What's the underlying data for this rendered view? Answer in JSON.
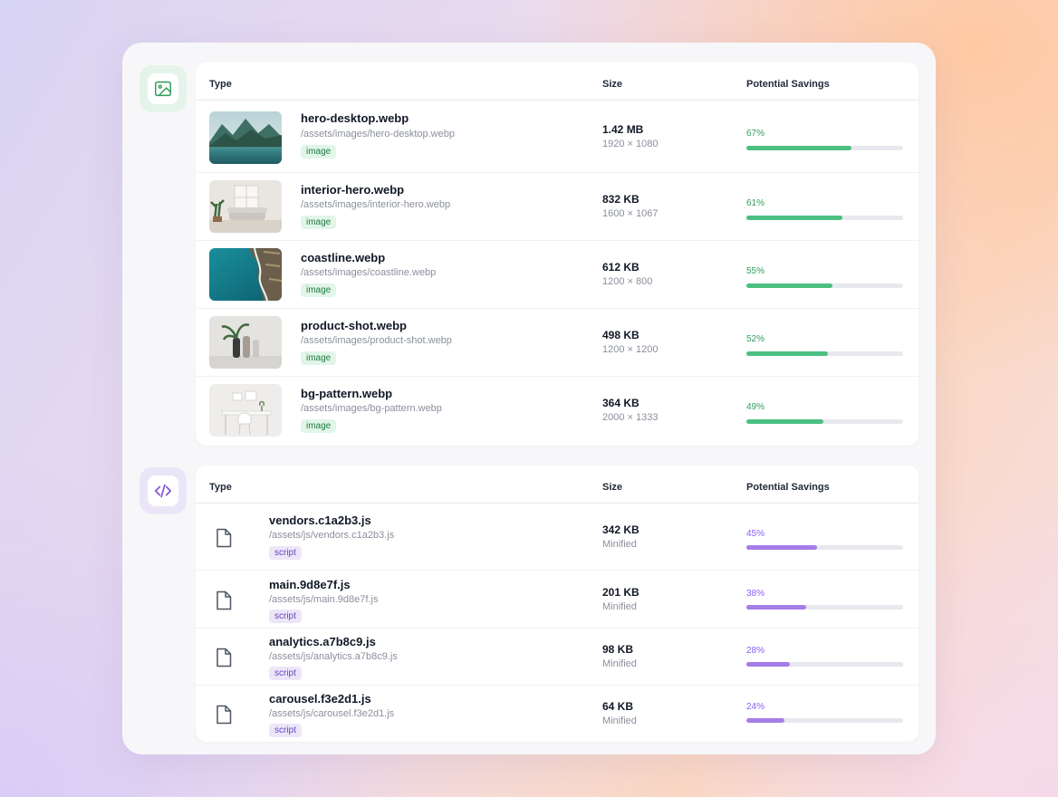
{
  "colors": {
    "image_accent": "#4cc083",
    "script_accent": "#a57de8",
    "track": "#e8e9ee"
  },
  "images_section": {
    "icon": "image-icon",
    "headers": {
      "type": "Type",
      "size": "Size",
      "savings": "Potential Savings"
    },
    "rows": [
      {
        "name": "hero-desktop.webp",
        "path": "/assets/images/hero-desktop.webp",
        "badge": "image",
        "size": "1.42 MB",
        "dims": "1920 × 1080",
        "savings_label": "67%",
        "savings": 0.67,
        "thumb": "mountain-lake"
      },
      {
        "name": "interior-hero.webp",
        "path": "/assets/images/interior-hero.webp",
        "badge": "image",
        "size": "832 KB",
        "dims": "1600 × 1067",
        "savings_label": "61%",
        "savings": 0.61,
        "thumb": "living-room"
      },
      {
        "name": "coastline.webp",
        "path": "/assets/images/coastline.webp",
        "badge": "image",
        "size": "612 KB",
        "dims": "1200 × 800",
        "savings_label": "55%",
        "savings": 0.55,
        "thumb": "aerial-coast"
      },
      {
        "name": "product-shot.webp",
        "path": "/assets/images/product-shot.webp",
        "badge": "image",
        "size": "498 KB",
        "dims": "1200 × 1200",
        "savings_label": "52%",
        "savings": 0.52,
        "thumb": "vases"
      },
      {
        "name": "bg-pattern.webp",
        "path": "/assets/images/bg-pattern.webp",
        "badge": "image",
        "size": "364 KB",
        "dims": "2000 × 1333",
        "savings_label": "49%",
        "savings": 0.49,
        "thumb": "white-desk"
      }
    ]
  },
  "scripts_section": {
    "icon": "code-icon",
    "headers": {
      "type": "Type",
      "size": "Size",
      "savings": "Potential Savings"
    },
    "rows": [
      {
        "name": "vendors.c1a2b3.js",
        "path": "/assets/js/vendors.c1a2b3.js",
        "badge": "script",
        "size": "342 KB",
        "note": "Minified",
        "savings_label": "45%",
        "savings": 0.45
      },
      {
        "name": "main.9d8e7f.js",
        "path": "/assets/js/main.9d8e7f.js",
        "badge": "script",
        "size": "201 KB",
        "note": "Minified",
        "savings_label": "38%",
        "savings": 0.38
      },
      {
        "name": "analytics.a7b8c9.js",
        "path": "/assets/js/analytics.a7b8c9.js",
        "badge": "script",
        "size": "98 KB",
        "note": "Minified",
        "savings_label": "28%",
        "savings": 0.28
      },
      {
        "name": "carousel.f3e2d1.js",
        "path": "/assets/js/carousel.f3e2d1.js",
        "badge": "script",
        "size": "64 KB",
        "note": "Minified",
        "savings_label": "24%",
        "savings": 0.24
      }
    ]
  }
}
